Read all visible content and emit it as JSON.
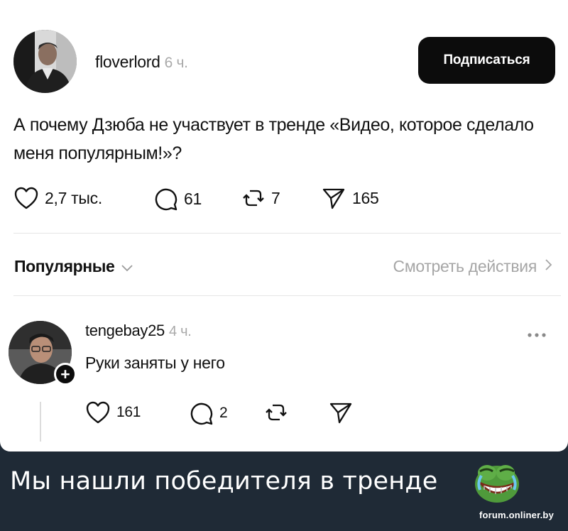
{
  "post": {
    "author": "floverlord",
    "time": "6 ч.",
    "subscribe_label": "Подписаться",
    "text": "А почему Дзюба не участвует в тренде «Видео, которое сделало меня популярным!»?",
    "actions": {
      "likes": "2,7 тыс.",
      "comments": "61",
      "reposts": "7",
      "shares": "165"
    }
  },
  "sort": {
    "label": "Популярные",
    "view_activity": "Смотреть действия"
  },
  "reply": {
    "author": "tengebay25",
    "time": "4 ч.",
    "text": "Руки заняты у него",
    "actions": {
      "likes": "161",
      "comments": "2"
    }
  },
  "caption": {
    "text": "Мы нашли победителя в тренде",
    "watermark": "forum.onliner.by"
  },
  "colors": {
    "button_bg": "#0c0c0c",
    "caption_bg": "#1f2a36",
    "muted_text": "#a6a6a6"
  },
  "icons": [
    "heart-icon",
    "comment-icon",
    "repost-icon",
    "share-icon",
    "chevron-down-icon",
    "chevron-right-icon",
    "more-icon",
    "plus-icon",
    "pepe-emoji-icon"
  ]
}
